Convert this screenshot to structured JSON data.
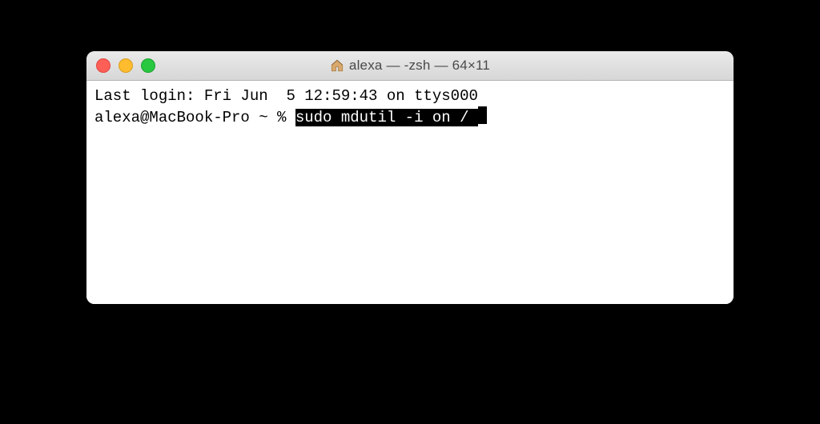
{
  "titlebar": {
    "icon": "home-icon",
    "title": "alexa — -zsh — 64×11"
  },
  "terminal": {
    "line1": "Last login: Fri Jun  5 12:59:43 on ttys000",
    "prompt": "alexa@MacBook-Pro ~ % ",
    "selected_command": "sudo mdutil -i on /"
  }
}
